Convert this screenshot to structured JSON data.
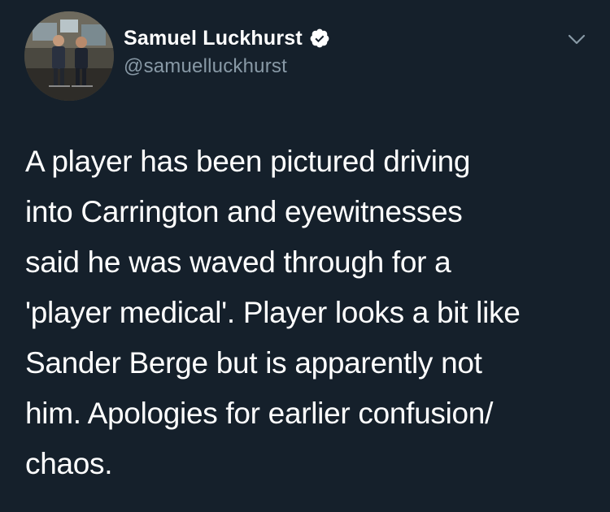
{
  "author": {
    "display_name": "Samuel Luckhurst",
    "handle": "@samuelluckhurst",
    "verified_icon": "verified-badge-icon",
    "avatar": "profile-photo"
  },
  "menu": {
    "icon": "chevron-down-icon"
  },
  "tweet": {
    "lines": [
      "A player has been pictured driving",
      "into Carrington and eyewitnesses",
      "said he was waved through for a",
      "'player medical'. Player looks a bit like",
      "Sander Berge but is apparently not",
      "him. Apologies for earlier confusion/",
      "chaos."
    ]
  },
  "colors": {
    "background": "#15202b",
    "text": "#ffffff",
    "secondary_text": "#8899a6"
  }
}
